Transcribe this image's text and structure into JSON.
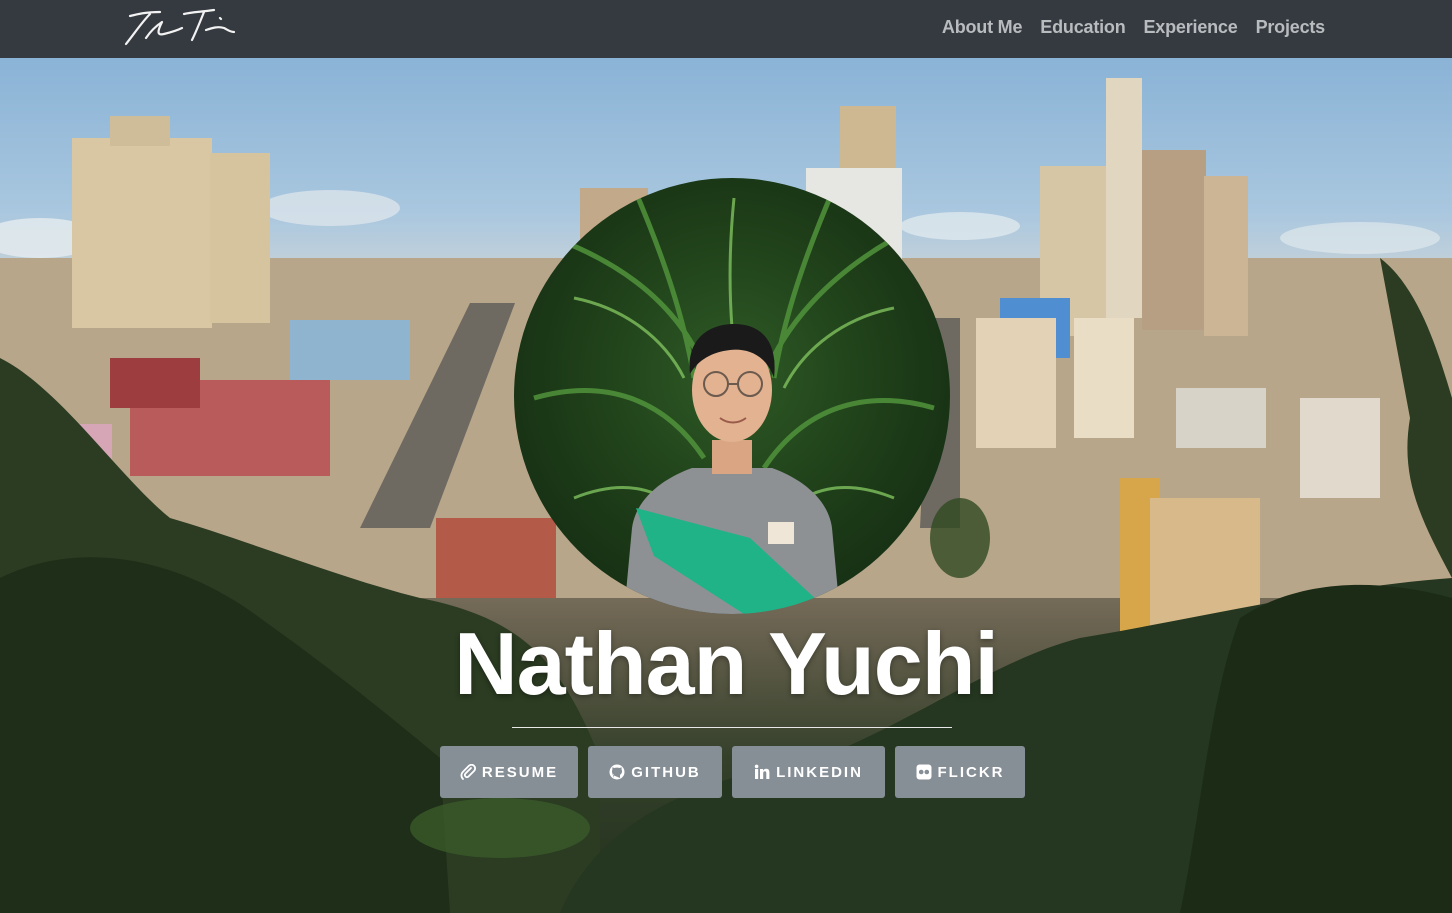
{
  "navbar": {
    "brand_icon": "signature-logo",
    "links": [
      "About Me",
      "Education",
      "Experience",
      "Projects"
    ]
  },
  "hero": {
    "background": "san-francisco-cityscape-photo",
    "portrait": "profile-photo-with-ferns",
    "name": "Nathan Yuchi",
    "buttons": [
      {
        "label": "RESUME",
        "icon": "paperclip-icon"
      },
      {
        "label": "GITHUB",
        "icon": "github-icon"
      },
      {
        "label": "LINKEDIN",
        "icon": "linkedin-icon"
      },
      {
        "label": "FLICKR",
        "icon": "flickr-icon"
      }
    ]
  },
  "colors": {
    "navbar": "#343a40",
    "nav_link": "#b9bcbf",
    "button": "#868e96",
    "title": "#ffffff"
  }
}
